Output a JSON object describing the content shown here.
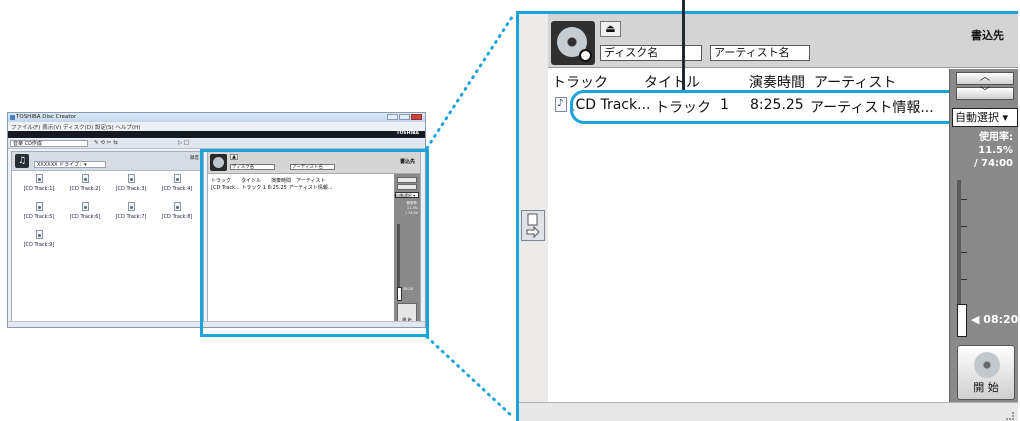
{
  "small_window": {
    "title": "TOSHIBA Disc Creator",
    "window_controls": [
      "—",
      "□",
      "✕"
    ],
    "menu": "ファイル(F)  表示(V)  ディスク(D)  設定(S)  ヘルプ(H)",
    "brand": "TOSHIBA",
    "toolbar_dropdown": "音楽 CD作成",
    "drive_dropdown": "XXXXXX ドライブ：▾",
    "source_label": "録音",
    "tracks": [
      "[CD Track:1]",
      "[CD Track:2]",
      "[CD Track:3]",
      "[CD Track:4]",
      "[CD Track:5]",
      "[CD Track:6]",
      "[CD Track:7]",
      "[CD Track:8]",
      "[CD Track:9]"
    ],
    "right": {
      "disc_name": "ディスク名",
      "artist_name": "アーティスト名",
      "dest": "書込先",
      "columns": "トラック　　タイトル　　演奏時間　アーティスト",
      "row": "[CD Track...  トラック 1   8:25.25  アーティスト情報...",
      "auto": "自動選択 ▾",
      "usage": "使用率:",
      "usage_pct": "11.5%",
      "usage_total": "/ 74:00",
      "time": "08:20",
      "start": "開 始"
    }
  },
  "zoom": {
    "eject_icon": "eject-icon",
    "disc_name_placeholder": "ディスク名",
    "artist_name_placeholder": "アーティスト名",
    "dest_label": "書込先",
    "columns": {
      "track": "トラック",
      "title": "タイトル",
      "duration": "演奏時間",
      "artist": "アーティスト"
    },
    "row": {
      "track": "[CD Track...",
      "title": "トラック",
      "number": "1",
      "duration": "8:25.25",
      "artist": "アーティスト情報..."
    },
    "scroll_up": "︿",
    "scroll_down": "﹀",
    "auto_select": "自動選択 ▾",
    "usage_label": "使用率:",
    "usage_pct": "11.5%",
    "usage_total": "/ 74:00",
    "time_marker": "◀ 08:20",
    "start_button": "開 始"
  },
  "colors": {
    "highlight": "#1aa4dc",
    "side_panel": "#8a8a8a"
  }
}
